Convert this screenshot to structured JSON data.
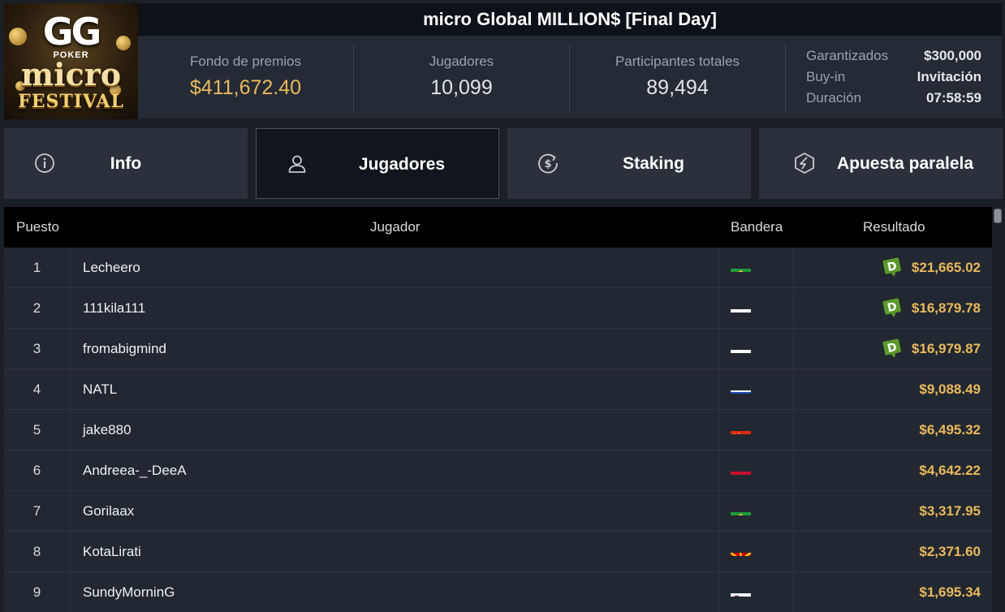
{
  "logo": {
    "gg": "GG",
    "poker": "POKER",
    "micro": "micro",
    "festival": "FESTIVAL"
  },
  "title": "micro Global MILLION$ [Final Day]",
  "stats": {
    "prize_label": "Fondo de premios",
    "prize_value": "$411,672.40",
    "players_label": "Jugadores",
    "players_value": "10,099",
    "entrants_label": "Participantes totales",
    "entrants_value": "89,494"
  },
  "details": {
    "guaranteed_label": "Garantizados",
    "guaranteed_value": "$300,000",
    "buyin_label": "Buy-in",
    "buyin_value": "Invitación",
    "duration_label": "Duración",
    "duration_value": "07:58:59"
  },
  "tabs": [
    {
      "label": "Info",
      "icon": "info-icon",
      "active": false
    },
    {
      "label": "Jugadores",
      "icon": "user-icon",
      "active": true
    },
    {
      "label": "Staking",
      "icon": "dollar-cycle-icon",
      "active": false
    },
    {
      "label": "Apuesta paralela",
      "icon": "side-bet-icon",
      "active": false
    }
  ],
  "table": {
    "headers": {
      "rank": "Puesto",
      "player": "Jugador",
      "flag": "Bandera",
      "result": "Resultado"
    },
    "rows": [
      {
        "rank": "1",
        "player": "Lecheero",
        "flag": "brazil",
        "result": "$21,665.02",
        "badge": true
      },
      {
        "rank": "2",
        "player": "111kila111",
        "flag": "russia",
        "result": "$16,879.78",
        "badge": true
      },
      {
        "rank": "3",
        "player": "fromabigmind",
        "flag": "russia",
        "result": "$16,979.87",
        "badge": true
      },
      {
        "rank": "4",
        "player": "NATL",
        "flag": "israel",
        "result": "$9,088.49",
        "badge": false
      },
      {
        "rank": "5",
        "player": "jake880",
        "flag": "china",
        "result": "$6,495.32",
        "badge": false
      },
      {
        "rank": "6",
        "player": "Andreea-_-DeeA",
        "flag": "austria",
        "result": "$4,642.22",
        "badge": false
      },
      {
        "rank": "7",
        "player": "Gorilaax",
        "flag": "brazil",
        "result": "$3,317.95",
        "badge": false
      },
      {
        "rank": "8",
        "player": "KotaLirati",
        "flag": "north-macedonia",
        "result": "$2,371.60",
        "badge": false
      },
      {
        "rank": "9",
        "player": "SundyMorninG",
        "flag": "slovenia",
        "result": "$1,695.34",
        "badge": false
      }
    ],
    "badge_letter": "D"
  },
  "colors": {
    "gold": "#e9b95c",
    "badge_green": "#5a9a2a",
    "header_bg": "#000000"
  }
}
